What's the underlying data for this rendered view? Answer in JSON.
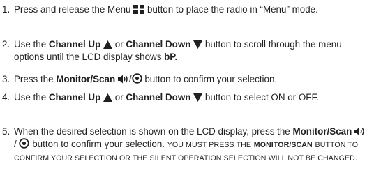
{
  "steps": [
    {
      "number": "1.",
      "text_a": "Press and release the Menu",
      "menu_icon": "menu-grid-icon",
      "text_b": "button to place the radio in “Menu” mode."
    },
    {
      "number": "2.",
      "text_a": "Use the",
      "bold_a": "Channel Up",
      "up_icon": "triangle-up-icon",
      "text_b": "or",
      "bold_b": "Channel Down",
      "down_icon": "triangle-down-icon",
      "text_c": "button to scroll through the menu options until the LCD display shows",
      "bold_c": "bP."
    },
    {
      "number": "3.",
      "text_a": "Press the",
      "bold_a": "Monitor/Scan",
      "speaker_icon": "speaker-icon",
      "slash": "/",
      "scan_icon": "scan-target-icon",
      "text_b": "button to confirm your selection."
    },
    {
      "number": "4.",
      "text_a": "Use the",
      "bold_a": "Channel Up",
      "up_icon": "triangle-up-icon",
      "text_b": "or",
      "bold_b": "Channel Down",
      "down_icon": "triangle-down-icon",
      "text_c": "button to select ON or OFF."
    },
    {
      "number": "5.",
      "text_a": "When the desired selection is shown on the LCD display, press the",
      "bold_a": "Monitor/Scan",
      "speaker_icon": "speaker-icon",
      "slash": "/",
      "scan_icon": "scan-target-icon",
      "text_b": "button to confirm your selection.",
      "caps_a": "YOU MUST PRESS THE",
      "caps_bold": "MONITOR/SCAN",
      "caps_b": "BUTTON TO CONFIRM YOUR SELECTION OR THE SILENT OPERATION SELECTION WILL NOT BE CHANGED."
    }
  ],
  "text_color": "#231f20"
}
